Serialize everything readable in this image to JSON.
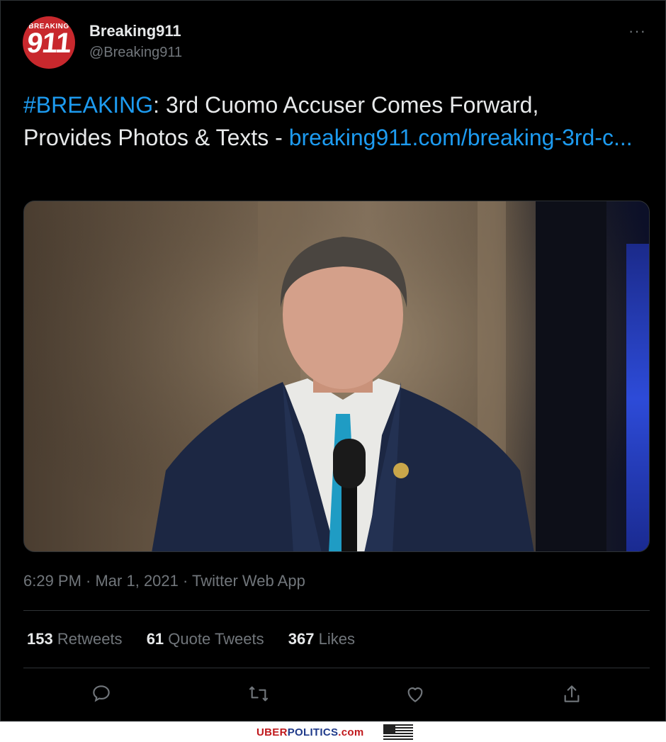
{
  "tweet": {
    "avatar_top": "BREAKING",
    "avatar_num": "911",
    "name": "Breaking911",
    "handle": "@Breaking911",
    "more_label": "···",
    "hashtag": "#BREAKING",
    "text": ": 3rd Cuomo Accuser Comes Forward, Provides Photos & Texts - ",
    "link": "breaking911.com/breaking-3rd-c...",
    "meta": "6:29 PM · Mar 1, 2021 · Twitter Web App",
    "stats": [
      {
        "count": "153",
        "label": "Retweets"
      },
      {
        "count": "61",
        "label": "Quote Tweets"
      },
      {
        "count": "367",
        "label": "Likes"
      }
    ],
    "actions": [
      "reply-icon",
      "retweet-icon",
      "like-icon",
      "share-icon"
    ]
  },
  "footer": {
    "brand_part1": "UBER",
    "brand_part2": "POLITICS",
    "brand_part3": ".com",
    "flag_icon": "us-flag-icon"
  },
  "colors": {
    "background": "#000000",
    "link": "#1d9bf0",
    "text": "#e7e9ea",
    "muted": "#71767b"
  }
}
